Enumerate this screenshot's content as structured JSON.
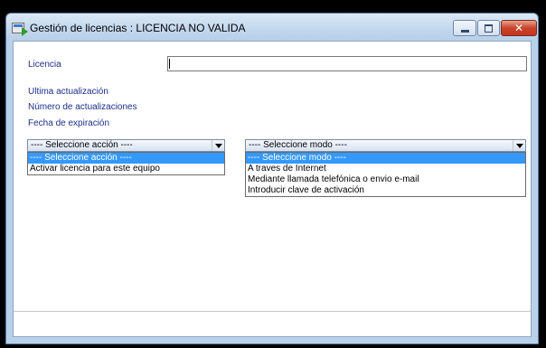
{
  "window": {
    "title": "Gestión de licencias : LICENCIA NO VALIDA",
    "controls": {
      "minimize": "minimize-icon",
      "maximize": "maximize-icon",
      "close": "close-icon"
    }
  },
  "form": {
    "licencia_label": "Licencia",
    "licencia_value": "",
    "ultima_actualizacion_label": "Ultima actualización",
    "numero_actualizaciones_label": "Número de actualizaciones",
    "fecha_expiracion_label": "Fecha de expiración"
  },
  "accion_combo": {
    "selected": "---- Seleccione acción ----",
    "options": [
      "---- Seleccione acción ----",
      "Activar licencia para este equipo"
    ]
  },
  "modo_combo": {
    "selected": "---- Seleccione modo ----",
    "options": [
      "---- Seleccione modo ----",
      "A traves de Internet",
      "Mediante llamada telefónica o envio e-mail",
      "Introducir clave de activación"
    ]
  },
  "colors": {
    "label_text": "#1c2e8a",
    "selection": "#3399ff",
    "close_button": "#c9442c"
  }
}
